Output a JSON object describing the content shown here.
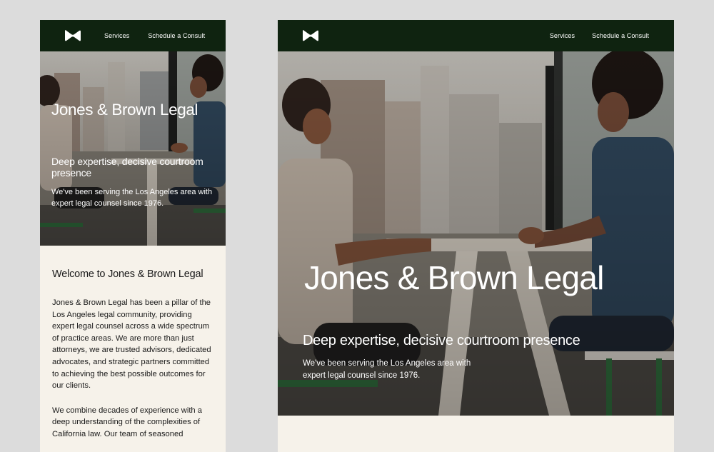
{
  "site": {
    "nav": {
      "services_label": "Services",
      "consult_label": "Schedule a Consult"
    },
    "hero": {
      "title": "Jones & Brown Legal",
      "subtitle": "Deep expertise, decisive courtroom presence",
      "body": "We've been serving the Los Angeles area with expert legal counsel since 1976."
    },
    "content": {
      "welcome_heading": "Welcome to Jones & Brown Legal",
      "paragraphs": [
        "Jones & Brown Legal has been a pillar of the Los Angeles legal community, providing expert legal counsel across a wide spectrum of practice areas. We are more than just attorneys, we are trusted advisors, dedicated advocates, and strategic partners committed to achieving the best possible outcomes for our clients.",
        "We combine decades of experience with a deep understanding of the complexities of California law. Our team of seasoned"
      ]
    }
  },
  "colors": {
    "nav_background": "#0f2310",
    "page_background": "#dcdcdc",
    "content_background": "#f6f2ea",
    "hero_text": "#ffffff"
  },
  "icons": {
    "logo": "bowtie-logo-icon"
  }
}
